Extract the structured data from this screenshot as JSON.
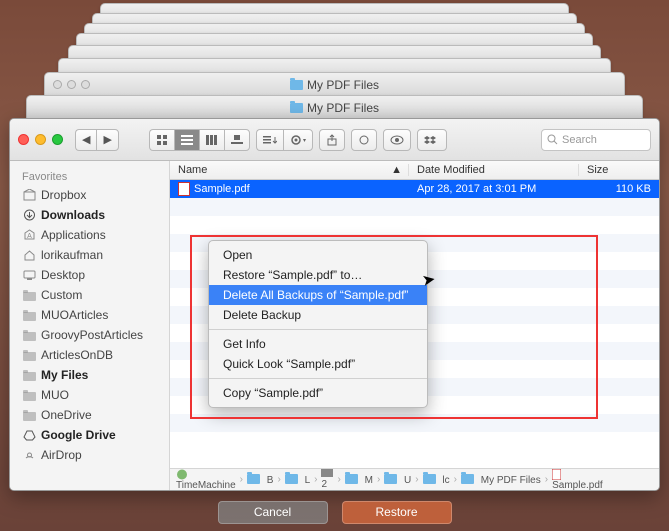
{
  "stacked_titles": {
    "back": "My PDF Files",
    "front": "My PDF Files"
  },
  "toolbar": {
    "search_placeholder": "Search"
  },
  "sidebar": {
    "header": "Favorites",
    "items": [
      {
        "label": "Dropbox",
        "ico": "box"
      },
      {
        "label": "Downloads",
        "ico": "dl",
        "bold": true
      },
      {
        "label": "Applications",
        "ico": "apps"
      },
      {
        "label": "lorikaufman",
        "ico": "home"
      },
      {
        "label": "Desktop",
        "ico": "desk"
      },
      {
        "label": "Custom",
        "ico": "folder"
      },
      {
        "label": "MUOArticles",
        "ico": "folder"
      },
      {
        "label": "GroovyPostArticles",
        "ico": "folder"
      },
      {
        "label": "ArticlesOnDB",
        "ico": "folder"
      },
      {
        "label": "My Files",
        "ico": "folder",
        "bold": true
      },
      {
        "label": "MUO",
        "ico": "folder"
      },
      {
        "label": "OneDrive",
        "ico": "folder"
      },
      {
        "label": "Google Drive",
        "ico": "gd",
        "bold": true
      },
      {
        "label": "AirDrop",
        "ico": "air"
      }
    ]
  },
  "columns": {
    "name": "Name",
    "date": "Date Modified",
    "size": "Size"
  },
  "row": {
    "name": "Sample.pdf",
    "date": "Apr 28, 2017 at 3:01 PM",
    "size": "110 KB"
  },
  "context_menu": {
    "items": [
      {
        "label": "Open"
      },
      {
        "label": "Restore “Sample.pdf” to…"
      },
      {
        "label": "Delete All Backups of “Sample.pdf”",
        "hl": true
      },
      {
        "label": "Delete Backup"
      },
      {
        "sep": true
      },
      {
        "label": "Get Info"
      },
      {
        "label": "Quick Look “Sample.pdf”"
      },
      {
        "sep": true
      },
      {
        "label": "Copy “Sample.pdf”"
      }
    ]
  },
  "pathbar": [
    "TimeMachine",
    "B",
    "L",
    "2",
    "M",
    "U",
    "lc",
    "My PDF Files",
    "Sample.pdf"
  ],
  "footer": {
    "cancel": "Cancel",
    "restore": "Restore"
  }
}
